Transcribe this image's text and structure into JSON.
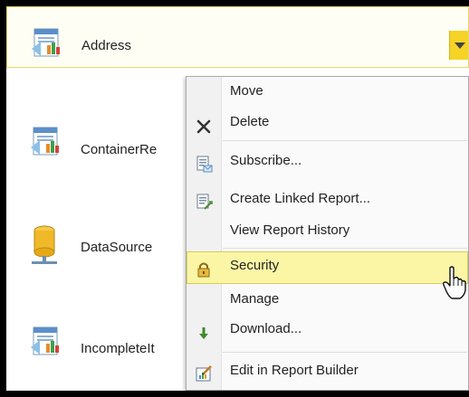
{
  "items": [
    {
      "label": "Address",
      "icon": "report-icon"
    },
    {
      "label": "ContainerRe",
      "icon": "report-icon"
    },
    {
      "label": "DataSource",
      "icon": "database-icon"
    },
    {
      "label": "IncompleteIt",
      "icon": "report-icon"
    }
  ],
  "menu": {
    "items": [
      {
        "label": "Move",
        "icon": ""
      },
      {
        "label": "Delete",
        "icon": "close-x-icon"
      },
      {
        "label": "Subscribe...",
        "icon": "subscribe-icon"
      },
      {
        "label": "Create Linked Report...",
        "icon": "linked-report-icon"
      },
      {
        "label": "View Report History",
        "icon": ""
      },
      {
        "label": "Security",
        "icon": "lock-icon",
        "highlighted": true
      },
      {
        "label": "Manage",
        "icon": ""
      },
      {
        "label": "Download...",
        "icon": "download-arrow-icon"
      },
      {
        "label": "Edit in Report Builder",
        "icon": "report-builder-icon"
      }
    ]
  },
  "colors": {
    "highlight": "#fbf6a6",
    "dropdown": "#f5d327",
    "header_border": "#e8d66a"
  }
}
